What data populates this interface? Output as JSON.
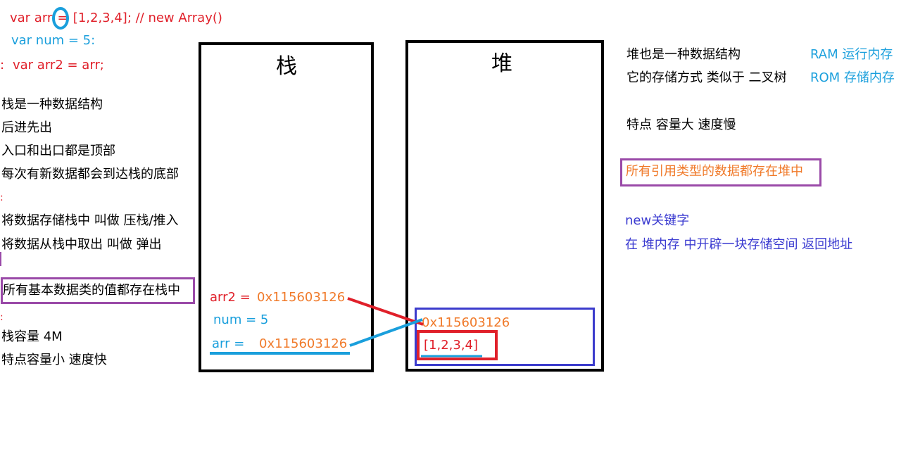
{
  "code": {
    "line1_pre": "var arr",
    "line1_eq": "=",
    "line1_post": "[1,2,3,4]; // new Array()",
    "line2": "var num = 5:",
    "line3_prefix": ":",
    "line3": "var     arr2 = arr;"
  },
  "stack_notes": {
    "items": [
      "栈是一种数据结构",
      "后进先出",
      "入口和出口都是顶部",
      "每次有新数据都会到达栈的底部",
      ":",
      "将数据存储栈中 叫做 压栈/推入",
      "将数据从栈中取出 叫做 弹出"
    ],
    "highlight": "所有基本数据类的值都存在栈中",
    "bottom_mark": ":",
    "capacity": "栈容量 4M",
    "feature": "特点容量小 速度快"
  },
  "stack_box": {
    "title": "栈",
    "arr2_label": "arr2 =",
    "arr2_value": "0x115603126",
    "num_label": "num = 5",
    "arr_label": "arr =",
    "arr_value": "0x115603126"
  },
  "heap_box": {
    "title": "堆",
    "address": "0x115603126",
    "array_value": "[1,2,3,4]"
  },
  "heap_notes": {
    "line1": "堆也是一种数据结构",
    "line2": "它的存储方式 类似于 二叉树",
    "ram": "RAM 运行内存",
    "rom": "ROM 存储内存",
    "feature": "特点 容量大 速度慢",
    "highlight": "所有引用类型的数据都存在堆中",
    "new_keyword": "new关键字",
    "new_desc": "在 堆内存 中开辟一块存储空间 返回地址"
  },
  "colors": {
    "red": "#e0202a",
    "blue": "#1a9fdc",
    "orange": "#f07a2a",
    "indigo": "#3a3ad0",
    "purple": "#9a4aa8",
    "heap_inner_box": "#3b3bcc"
  }
}
